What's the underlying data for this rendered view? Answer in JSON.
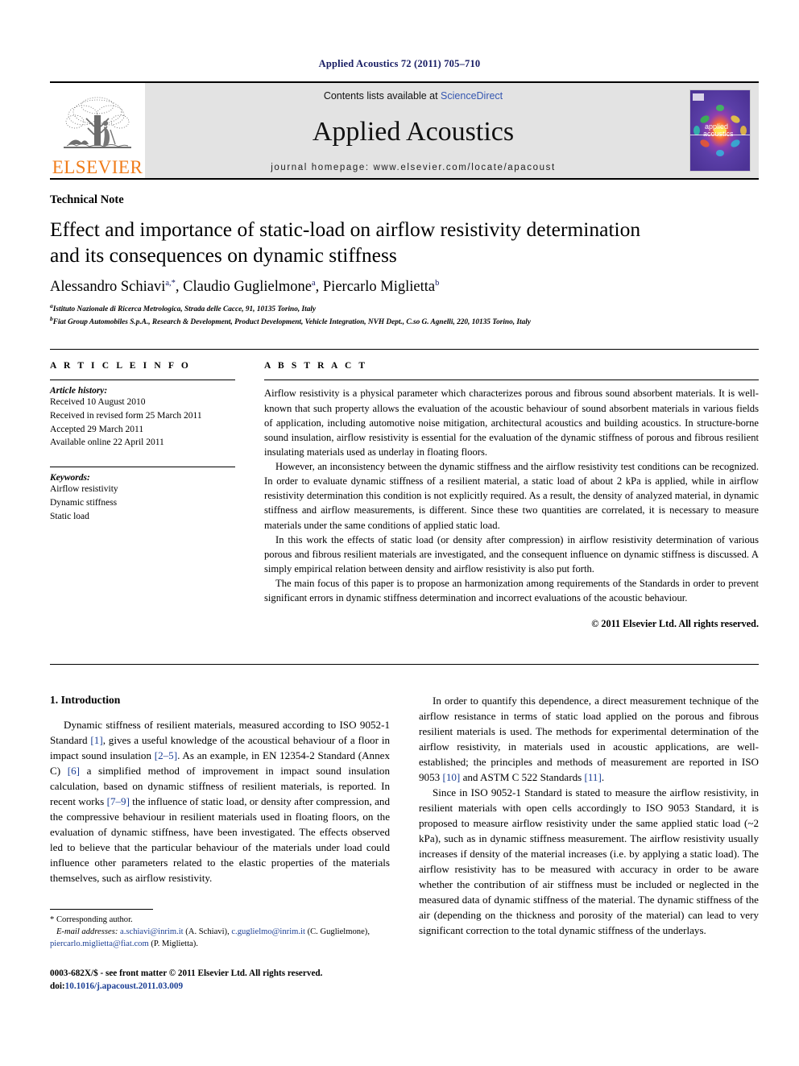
{
  "running_head": "Applied Acoustics 72 (2011) 705–710",
  "masthead": {
    "publisher_name": "ELSEVIER",
    "contents_prefix": "Contents lists available at ",
    "contents_link": "ScienceDirect",
    "journal_title": "Applied Acoustics",
    "homepage_label": "journal homepage: www.elsevier.com/locate/apacoust",
    "cover_title_line1": "applied",
    "cover_title_line2": "acoustics",
    "link_color": "#3456b0",
    "brand_color": "#f07c1a",
    "band_bg": "#e3e3e3"
  },
  "article": {
    "section_type": "Technical Note",
    "title_line1": "Effect and importance of static-load on airflow resistivity determination",
    "title_line2": "and its consequences on dynamic stiffness",
    "authors": [
      {
        "name": "Alessandro Schiavi",
        "marks": "a,*"
      },
      {
        "name": "Claudio Guglielmone",
        "marks": "a"
      },
      {
        "name": "Piercarlo Miglietta",
        "marks": "b"
      }
    ],
    "affiliations": [
      {
        "mark": "a",
        "text": "Istituto Nazionale di Ricerca Metrologica, Strada delle Cacce, 91, 10135 Torino, Italy"
      },
      {
        "mark": "b",
        "text": "Fiat Group Automobiles S.p.A., Research & Development, Product Development, Vehicle Integration, NVH Dept., C.so G. Agnelli, 220, 10135 Torino, Italy"
      }
    ]
  },
  "article_info": {
    "heading": "A R T I C L E    I N F O",
    "history_label": "Article history:",
    "history": [
      "Received 10 August 2010",
      "Received in revised form 25 March 2011",
      "Accepted 29 March 2011",
      "Available online 22 April 2011"
    ],
    "keywords_label": "Keywords:",
    "keywords": [
      "Airflow resistivity",
      "Dynamic stiffness",
      "Static load"
    ]
  },
  "abstract": {
    "heading": "A B S T R A C T",
    "paragraphs": [
      "Airflow resistivity is a physical parameter which characterizes porous and fibrous sound absorbent materials. It is well-known that such property allows the evaluation of the acoustic behaviour of sound absorbent materials in various fields of application, including automotive noise mitigation, architectural acoustics and building acoustics. In structure-borne sound insulation, airflow resistivity is essential for the evaluation of the dynamic stiffness of porous and fibrous resilient insulating materials used as underlay in floating floors.",
      "However, an inconsistency between the dynamic stiffness and the airflow resistivity test conditions can be recognized. In order to evaluate dynamic stiffness of a resilient material, a static load of about 2 kPa is applied, while in airflow resistivity determination this condition is not explicitly required. As a result, the density of analyzed material, in dynamic stiffness and airflow measurements, is different. Since these two quantities are correlated, it is necessary to measure materials under the same conditions of applied static load.",
      "In this work the effects of static load (or density after compression) in airflow resistivity determination of various porous and fibrous resilient materials are investigated, and the consequent influence on dynamic stiffness is discussed. A simply empirical relation between density and airflow resistivity is also put forth.",
      "The main focus of this paper is to propose an harmonization among requirements of the Standards in order to prevent significant errors in dynamic stiffness determination and incorrect evaluations of the acoustic behaviour."
    ],
    "copyright": "© 2011 Elsevier Ltd. All rights reserved."
  },
  "introduction": {
    "heading": "1. Introduction",
    "left_paragraph_parts": [
      "Dynamic stiffness of resilient materials, measured according to ISO 9052-1 Standard ",
      "[1]",
      ", gives a useful knowledge of the acoustical behaviour of a floor in impact sound insulation ",
      "[2–5]",
      ". As an example, in EN 12354-2 Standard (Annex C) ",
      "[6]",
      " a simplified method of improvement in impact sound insulation calculation, based on dynamic stiffness of resilient materials, is reported. In recent works ",
      "[7–9]",
      " the influence of static load, or density after compression, and the compressive behaviour in resilient materials used in floating floors, on the evaluation of dynamic stiffness, have been investigated. The effects observed led to believe that the particular behaviour of the materials under load could influence other parameters related to the elastic properties of the materials themselves, such as airflow resistivity."
    ],
    "right_paragraph_1_parts": [
      "In order to quantify this dependence, a direct measurement technique of the airflow resistance in terms of static load applied on the porous and fibrous resilient materials is used. The methods for experimental determination of the airflow resistivity, in materials used in acoustic applications, are well-established; the principles and methods of measurement are reported in ISO 9053 ",
      "[10]",
      " and ASTM C 522 Standards ",
      "[11]",
      "."
    ],
    "right_paragraph_2": "Since in ISO 9052-1 Standard is stated to measure the airflow resistivity, in resilient materials with open cells accordingly to ISO 9053 Standard, it is proposed to measure airflow resistivity under the same applied static load (~2 kPa), such as in dynamic stiffness measurement. The airflow resistivity usually increases if density of the material increases (i.e. by applying a static load). The airflow resistivity has to be measured with accuracy in order to be aware whether the contribution of air stiffness must be included or neglected in the measured data of dynamic stiffness of the material. The dynamic stiffness of the air (depending on the thickness and porosity of the material) can lead to very significant correction to the total dynamic stiffness of the underlays."
  },
  "footnote": {
    "corresponding_marker": "*",
    "corresponding_text": "Corresponding author.",
    "email_label": "E-mail addresses:",
    "emails": [
      {
        "address": "a.schiavi@inrim.it",
        "person": "(A. Schiavi)"
      },
      {
        "address": "c.guglielmo@inrim.it",
        "person": "(C. Guglielmone)"
      },
      {
        "address": "piercarlo.miglietta@fiat.com",
        "person": "(P. Miglietta)"
      }
    ]
  },
  "imprint": {
    "line1": "0003-682X/$ - see front matter © 2011 Elsevier Ltd. All rights reserved.",
    "doi_label": "doi:",
    "doi_value": "10.1016/j.apacoust.2011.03.009"
  }
}
